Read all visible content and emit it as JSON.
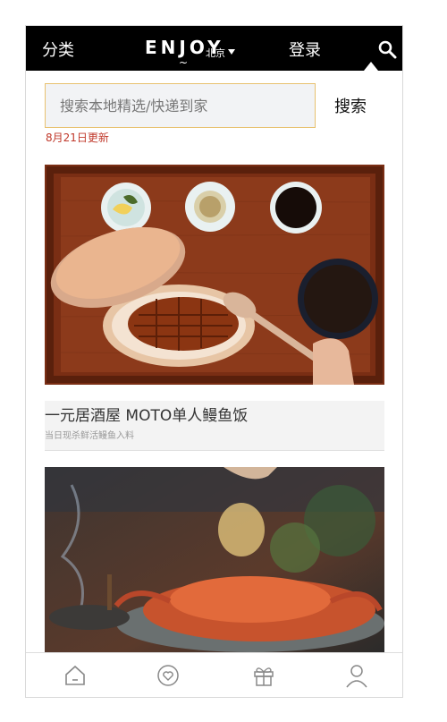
{
  "header": {
    "category": "分类",
    "logo": "ENJOY",
    "logo_sub": "~",
    "city": "北京",
    "login": "登录"
  },
  "search": {
    "placeholder": "搜索本地精选/快递到家",
    "button": "搜索",
    "update_note": "8月21日更新"
  },
  "feed": [
    {
      "title": "一元居酒屋 MOTO单人鳗鱼饭",
      "subtitle": "当日现杀鲜活鳗鱼入料"
    }
  ],
  "icons": {
    "nav": [
      "home-icon",
      "heart-icon",
      "gift-icon",
      "user-icon"
    ],
    "header": "search-icon"
  }
}
